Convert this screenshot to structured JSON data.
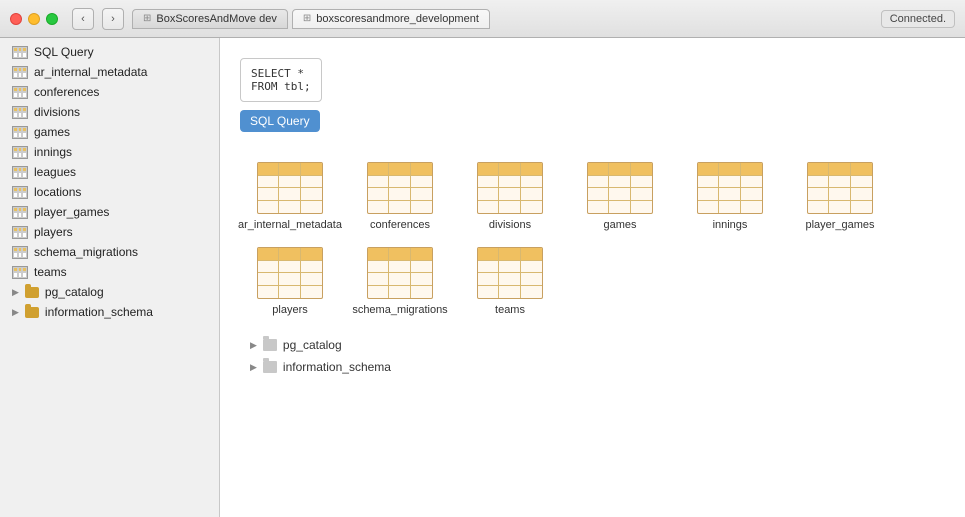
{
  "titlebar": {
    "tab1_label": "BoxScoresAndMove dev",
    "tab2_label": "boxscoresandmore_development",
    "connected_label": "Connected."
  },
  "sidebar": {
    "sql_query_label": "SQL Query",
    "items": [
      {
        "name": "ar_internal_metadata",
        "type": "table"
      },
      {
        "name": "conferences",
        "type": "table"
      },
      {
        "name": "divisions",
        "type": "table"
      },
      {
        "name": "games",
        "type": "table"
      },
      {
        "name": "innings",
        "type": "table"
      },
      {
        "name": "leagues",
        "type": "table"
      },
      {
        "name": "locations",
        "type": "table"
      },
      {
        "name": "player_games",
        "type": "table"
      },
      {
        "name": "players",
        "type": "table"
      },
      {
        "name": "schema_migrations",
        "type": "table"
      },
      {
        "name": "teams",
        "type": "table"
      }
    ],
    "folders": [
      {
        "name": "pg_catalog"
      },
      {
        "name": "information_schema"
      }
    ]
  },
  "content": {
    "sql_placeholder": "SELECT *\nFROM tbl;",
    "sql_button_label": "SQL Query",
    "tables": [
      {
        "name": "ar_internal_metadata"
      },
      {
        "name": "conferences"
      },
      {
        "name": "divisions"
      },
      {
        "name": "games"
      },
      {
        "name": "innings"
      },
      {
        "name": "player_games"
      },
      {
        "name": "players"
      },
      {
        "name": "schema_migrations"
      },
      {
        "name": "teams"
      }
    ],
    "folders": [
      {
        "name": "pg_catalog"
      },
      {
        "name": "information_schema"
      }
    ]
  }
}
